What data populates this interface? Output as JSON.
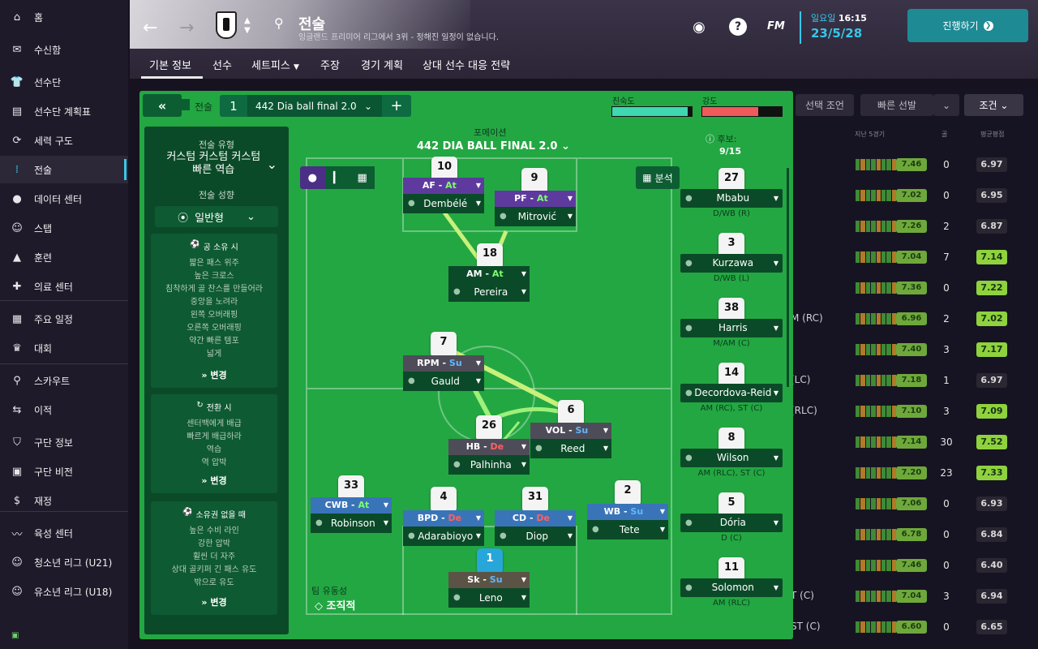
{
  "sidebar": {
    "items": [
      {
        "label": "홈",
        "icon": "home-icon"
      },
      {
        "label": "수신함",
        "icon": "inbox-icon"
      },
      {
        "label": "선수단",
        "icon": "squad-icon"
      },
      {
        "label": "선수단 계획표",
        "icon": "squad-planner-icon"
      },
      {
        "label": "세력 구도",
        "icon": "dynamics-icon"
      },
      {
        "label": "전술",
        "icon": "tactics-icon",
        "active": true
      },
      {
        "label": "데이터 센터",
        "icon": "data-hub-icon"
      },
      {
        "label": "스탭",
        "icon": "staff-icon"
      },
      {
        "label": "훈련",
        "icon": "training-icon"
      },
      {
        "label": "의료 센터",
        "icon": "medical-icon"
      },
      {
        "label": "주요 일정",
        "icon": "schedule-icon"
      },
      {
        "label": "대회",
        "icon": "trophy-icon"
      },
      {
        "label": "스카우트",
        "icon": "scouting-icon"
      },
      {
        "label": "이적",
        "icon": "transfers-icon"
      },
      {
        "label": "구단 정보",
        "icon": "club-info-icon"
      },
      {
        "label": "구단 비전",
        "icon": "club-vision-icon"
      },
      {
        "label": "재정",
        "icon": "finances-icon"
      },
      {
        "label": "육성 센터",
        "icon": "development-icon"
      },
      {
        "label": "청소년 리그 (U21)",
        "icon": "u21-icon"
      },
      {
        "label": "유소년 리그 (U18)",
        "icon": "u18-icon"
      }
    ]
  },
  "header": {
    "title": "전술",
    "subtitle": "잉글랜드 프리미어 리그에서 3위 - 정해진 일정이 없습니다.",
    "date_day": "일요일",
    "date_time": "16:15",
    "date": "23/5/28",
    "continue": "진행하기",
    "fm": "FM"
  },
  "tabs": [
    "기본 정보",
    "선수",
    "세트피스",
    "주장",
    "경기 계획",
    "상대 선수 대응 전략"
  ],
  "background": {
    "buttons": [
      "선택 조언",
      "빠른 선발",
      "조건"
    ],
    "col_form": "지난 5경기",
    "col_goals": "골",
    "col_rating": "평균평점",
    "rows": [
      {
        "pos": "",
        "form": "7.46",
        "g": "0",
        "r": "6.97",
        "rg": false
      },
      {
        "pos": "",
        "form": "7.02",
        "g": "0",
        "r": "6.95",
        "rg": false
      },
      {
        "pos": "",
        "form": "7.26",
        "g": "2",
        "r": "6.87",
        "rg": false
      },
      {
        "pos": "",
        "form": "7.04",
        "g": "7",
        "r": "7.14",
        "rg": true
      },
      {
        "pos": "",
        "form": "7.36",
        "g": "0",
        "r": "7.22",
        "rg": true
      },
      {
        "pos": "M (RC)",
        "form": "6.96",
        "g": "2",
        "r": "7.02",
        "rg": true
      },
      {
        "pos": "",
        "form": "7.40",
        "g": "3",
        "r": "7.17",
        "rg": true
      },
      {
        "pos": "(LC)",
        "form": "7.18",
        "g": "1",
        "r": "6.97",
        "rg": false
      },
      {
        "pos": "(RLC)",
        "form": "7.10",
        "g": "3",
        "r": "7.09",
        "rg": true
      },
      {
        "pos": "",
        "form": "7.14",
        "g": "30",
        "r": "7.52",
        "rg": true
      },
      {
        "pos": "",
        "form": "7.20",
        "g": "23",
        "r": "7.33",
        "rg": true
      },
      {
        "pos": "",
        "form": "7.06",
        "g": "0",
        "r": "6.93",
        "rg": false
      },
      {
        "pos": "",
        "form": "6.78",
        "g": "0",
        "r": "6.84",
        "rg": false
      },
      {
        "pos": "",
        "form": "7.46",
        "g": "0",
        "r": "6.40",
        "rg": false
      },
      {
        "pos": "T (C)",
        "form": "7.04",
        "g": "3",
        "r": "6.94",
        "rg": false
      },
      {
        "pos": "ST (C)",
        "form": "6.60",
        "g": "0",
        "r": "6.65",
        "rg": false
      }
    ]
  },
  "tactic": {
    "label": "전술",
    "slot": "1",
    "name": "442 Dia ball final 2.0",
    "fluidity_label": "팀 유동성",
    "fluidity": "조직적"
  },
  "meters": {
    "tempo_label": "친숙도",
    "intensity_label": "강도",
    "tempo": 0.95,
    "intensity": 0.7,
    "tempo_color": "#3fd8b0",
    "intensity_color": "#f05a5a"
  },
  "left": {
    "style_label": "전술 유형",
    "style_value": "커스텀 커스텀 커스텀 빠른 역습",
    "mentality_label": "전술 성향",
    "mentality": "일반형",
    "boxes": [
      {
        "title": "공 소유 시",
        "items": [
          "짧은 패스 위주",
          "높은 크로스",
          "침착하게 골 찬스를 만들어라",
          "중앙을 노려라",
          "왼쪽 오버래핑",
          "오른쪽 오버래핑",
          "약간 빠른 템포",
          "넓게"
        ],
        "btn": "변경"
      },
      {
        "title": "전환 시",
        "items": [
          "센터백에게 배급",
          "빠르게 배급하라",
          "역습",
          "역 압박"
        ],
        "btn": "변경"
      },
      {
        "title": "소유권 없을 때",
        "items": [
          "높은 수비 라인",
          "강한 압박",
          "휠씬 더 자주",
          "상대 골키퍼 긴 패스 유도",
          "밖으로 유도"
        ],
        "btn": "변경"
      }
    ]
  },
  "formation": {
    "label": "포메이션",
    "name": "442 DIA BALL FINAL 2.0",
    "analysis": "분석"
  },
  "players": [
    {
      "num": "10",
      "role": "AF",
      "duty": "At",
      "name": "Dembélé"
    },
    {
      "num": "9",
      "role": "PF",
      "duty": "At",
      "name": "Mitrović"
    },
    {
      "num": "18",
      "role": "AM",
      "duty": "At",
      "name": "Pereira"
    },
    {
      "num": "7",
      "role": "RPM",
      "duty": "Su",
      "name": "Gauld"
    },
    {
      "num": "6",
      "role": "VOL",
      "duty": "Su",
      "name": "Reed"
    },
    {
      "num": "26",
      "role": "HB",
      "duty": "De",
      "name": "Palhinha"
    },
    {
      "num": "33",
      "role": "CWB",
      "duty": "At",
      "name": "Robinson"
    },
    {
      "num": "4",
      "role": "BPD",
      "duty": "De",
      "name": "Adarabioyo"
    },
    {
      "num": "31",
      "role": "CD",
      "duty": "De",
      "name": "Diop"
    },
    {
      "num": "2",
      "role": "WB",
      "duty": "Su",
      "name": "Tete"
    },
    {
      "num": "1",
      "role": "Sk",
      "duty": "Su",
      "name": "Leno"
    }
  ],
  "candidates": {
    "title": "후보:",
    "count": "9/15",
    "list": [
      {
        "num": "27",
        "name": "Mbabu",
        "pos": "D/WB (R)"
      },
      {
        "num": "3",
        "name": "Kurzawa",
        "pos": "D/WB (L)"
      },
      {
        "num": "38",
        "name": "Harris",
        "pos": "M/AM (C)"
      },
      {
        "num": "14",
        "name": "Decordova-Reid",
        "pos": "AM (RC), ST (C)"
      },
      {
        "num": "8",
        "name": "Wilson",
        "pos": "AM (RLC), ST (C)"
      },
      {
        "num": "5",
        "name": "Dória",
        "pos": "D (C)"
      },
      {
        "num": "11",
        "name": "Solomon",
        "pos": "AM (RLC)"
      }
    ]
  }
}
